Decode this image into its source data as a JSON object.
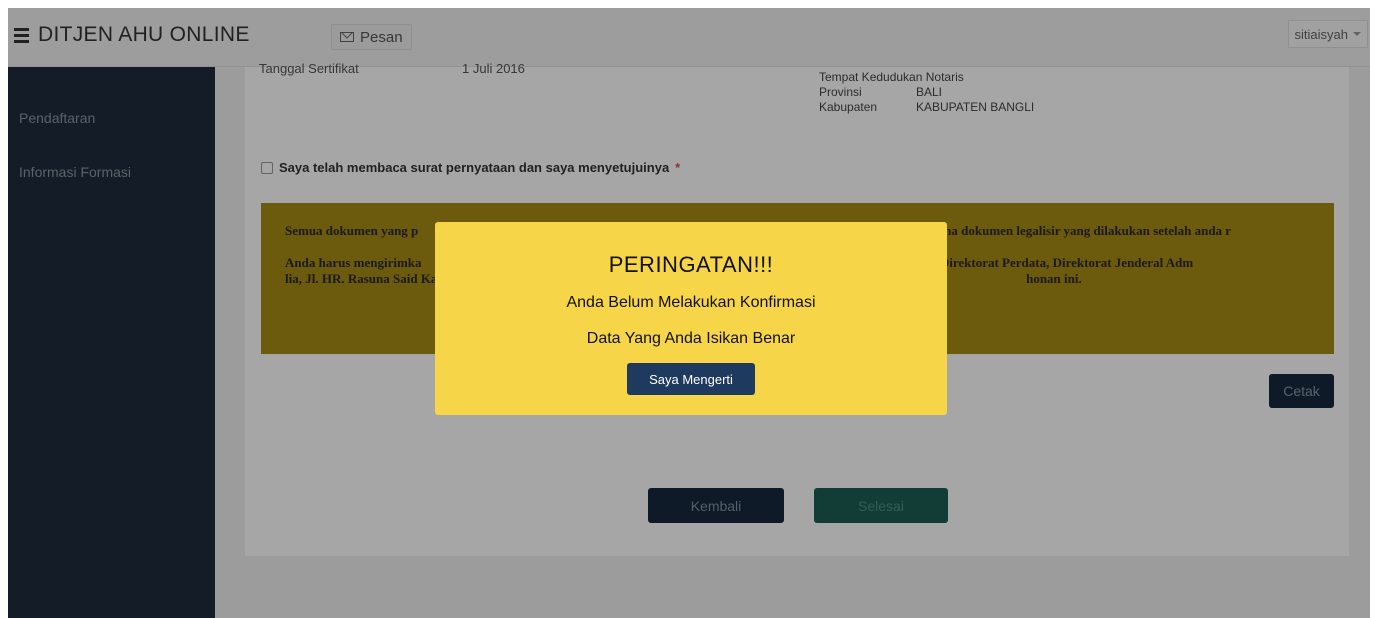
{
  "topbar": {
    "brand": "DITJEN AHU ONLINE",
    "pesan_label": "Pesan",
    "username": "sitiaisyah"
  },
  "sidebar": {
    "items": [
      {
        "label": "Pendaftaran"
      },
      {
        "label": "Informasi Formasi"
      }
    ]
  },
  "form": {
    "truncated_label": "Tanggal Sertifikat",
    "truncated_value": "1 Juli 2016",
    "address": {
      "heading": "Tempat Kedudukan Notaris",
      "rows": [
        {
          "key": "Provinsi",
          "value": "BALI"
        },
        {
          "key": "Kabupaten",
          "value": "KABUPATEN BANGLI"
        }
      ]
    },
    "agree_text": "Saya telah membaca surat pernyataan dan saya menyetujuinya",
    "agree_required_mark": "*",
    "notice": {
      "paragraph1": "Semua dokumen yang p                                                                                                                erifikator tidak akan menerima dokumen legalisir yang dilakukan setelah anda r",
      "paragraph2": "Anda harus mengirimka                                                                                                    i kepada : Subdirektorat Notariat, Direktorat Perdata, Direktorat Jenderal Adm                                                                                              lia, Jl. HR. Rasuna Said Kav x-6/8 Lantai 3 dan 6. Kuningan, Jakarta Selat                                                                                                    honan ini."
    },
    "cetak_label": "Cetak",
    "kembali_label": "Kembali",
    "selesai_label": "Selesai"
  },
  "modal": {
    "title": "PERINGATAN!!!",
    "line1": "Anda Belum Melakukan Konfirmasi",
    "line2": "Data Yang Anda Isikan Benar",
    "button_label": "Saya Mengerti"
  },
  "colors": {
    "sidebar_bg": "#1f2d3d",
    "modal_bg": "#f7d548",
    "primary_btn": "#1e3a5f",
    "success_btn": "#1d5f54"
  },
  "icons": {
    "menu": "hamburger-icon",
    "mail": "mail-icon",
    "dropdown": "caret-down-icon"
  }
}
